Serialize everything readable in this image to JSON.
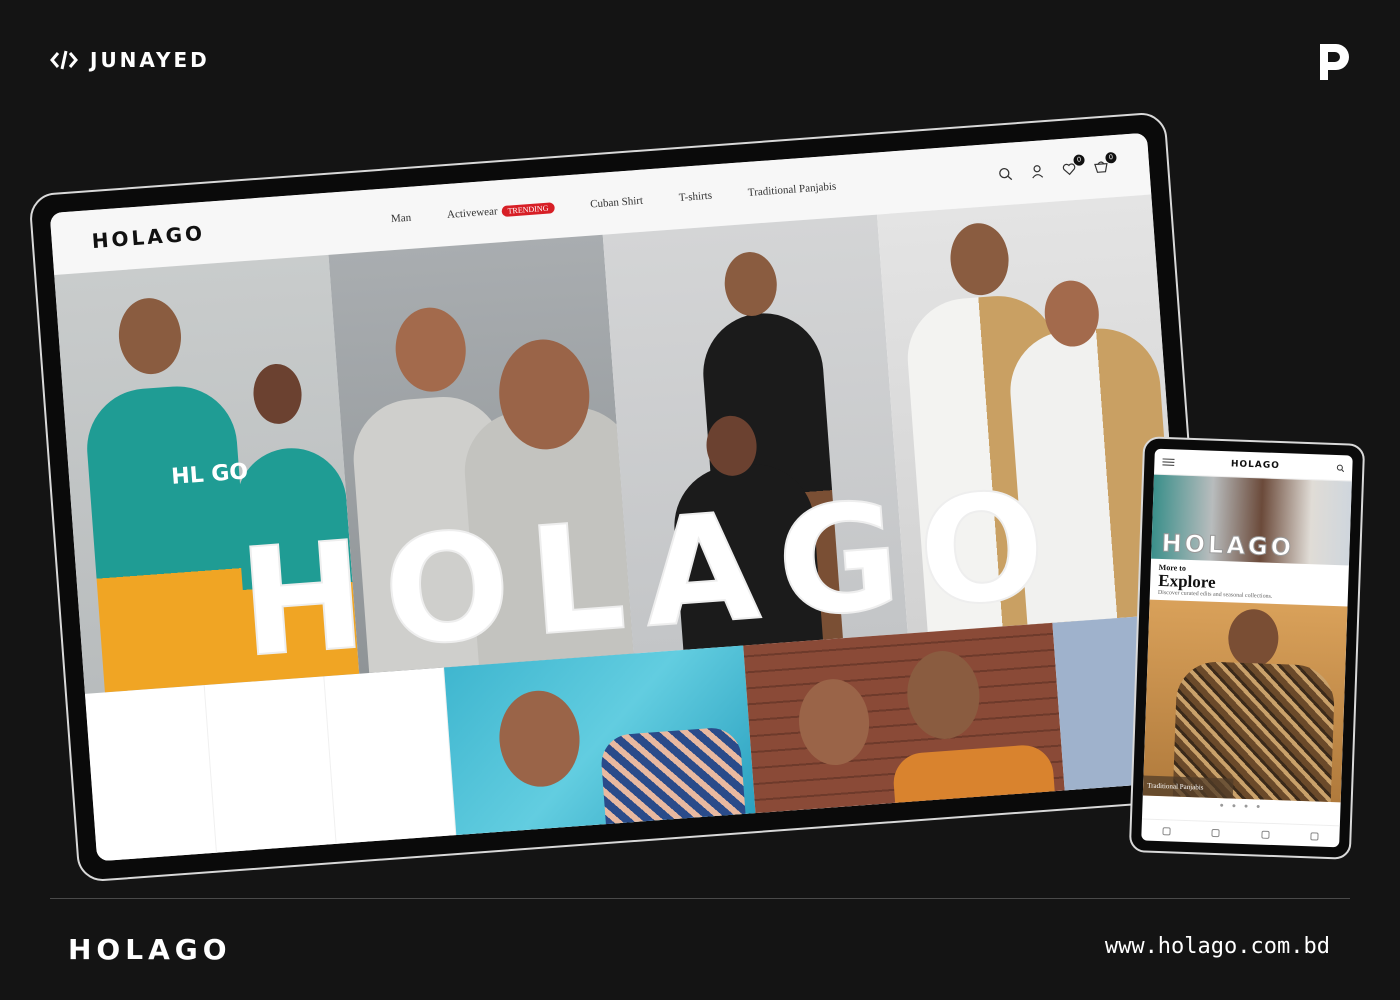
{
  "brand": {
    "name": "JUNAYED"
  },
  "site": {
    "logo": "HOLAGO",
    "nav": [
      {
        "label": "Man"
      },
      {
        "label": "Activewear",
        "badge": "TRENDING"
      },
      {
        "label": "Cuban Shirt"
      },
      {
        "label": "T-shirts"
      },
      {
        "label": "Traditional Panjabis"
      }
    ],
    "wishlist_count": "0",
    "cart_count": "0",
    "hero_word": "HOLAGO",
    "hoodie_print": "HL GO"
  },
  "phone": {
    "logo": "HOLAGO",
    "hero_word": "HOLAGO",
    "more_to": "More to",
    "explore_title": "Explore",
    "explore_subtitle": "Discover curated edits and seasonal collections.",
    "product_caption": "Traditional Panjabis",
    "dots": "● ● ● ●"
  },
  "footer": {
    "brand": "HOLAGO",
    "url": "www.holago.com.bd"
  },
  "colors": {
    "background": "#141414",
    "trending_badge": "#d71f26",
    "frame": "#d9d9d9"
  }
}
